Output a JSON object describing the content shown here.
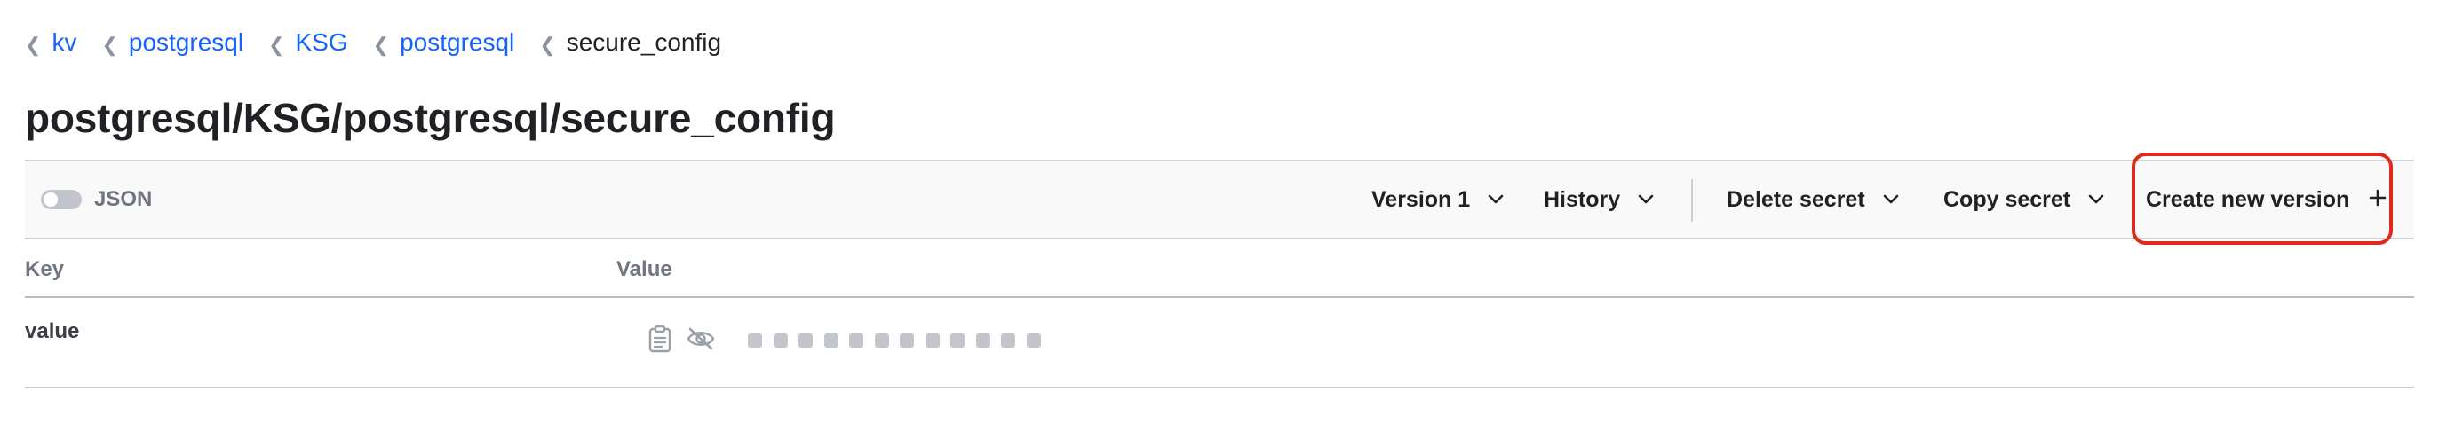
{
  "breadcrumb": {
    "items": [
      {
        "label": "kv"
      },
      {
        "label": "postgresql"
      },
      {
        "label": "KSG"
      },
      {
        "label": "postgresql"
      }
    ],
    "current": "secure_config"
  },
  "page": {
    "title": "postgresql/KSG/postgresql/secure_config"
  },
  "toolbar": {
    "json_label": "JSON",
    "json_enabled": false,
    "version_label": "Version 1",
    "history_label": "History",
    "delete_label": "Delete secret",
    "copy_label": "Copy secret",
    "create_label": "Create new version",
    "highlight_color": "#e0291a"
  },
  "table": {
    "headers": {
      "key": "Key",
      "value": "Value"
    },
    "rows": [
      {
        "key": "value",
        "masked": true
      }
    ]
  },
  "colors": {
    "link": "#1563ff",
    "text": "#1f2124",
    "muted": "#6f7682"
  }
}
